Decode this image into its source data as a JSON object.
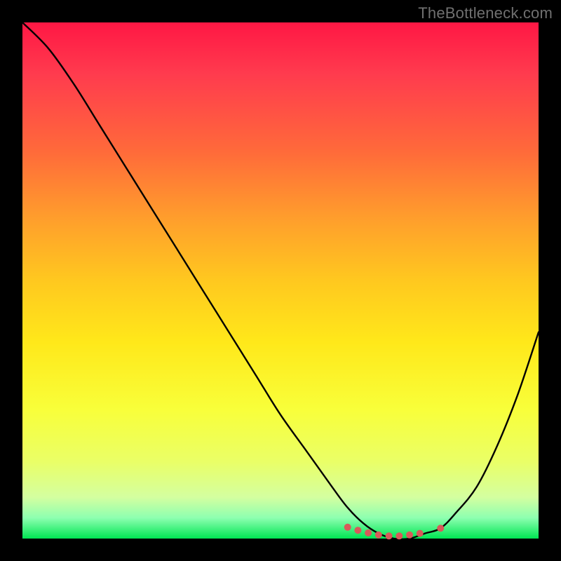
{
  "watermark": "TheBottleneck.com",
  "colors": {
    "frame": "#000000",
    "gradient_top": "#ff1744",
    "gradient_mid": "#ffe81a",
    "gradient_bottom": "#00e653",
    "curve": "#000000",
    "dots": "#d85a5a"
  },
  "chart_data": {
    "type": "line",
    "title": "",
    "xlabel": "",
    "ylabel": "",
    "xlim": [
      0,
      100
    ],
    "ylim": [
      0,
      100
    ],
    "note": "Values estimated from pixel positions on a 0–100 normalized axis. Higher y = higher on image (closer to red). Curve descends from top-left, bottoms out near x≈73, then rises toward the right edge.",
    "series": [
      {
        "name": "bottleneck-curve",
        "x": [
          0,
          5,
          10,
          15,
          20,
          25,
          30,
          35,
          40,
          45,
          50,
          55,
          60,
          63,
          66,
          69,
          72,
          75,
          78,
          81,
          84,
          88,
          92,
          96,
          100
        ],
        "y": [
          100,
          95,
          88,
          80,
          72,
          64,
          56,
          48,
          40,
          32,
          24,
          17,
          10,
          6,
          3,
          1,
          0,
          0,
          1,
          2,
          5,
          10,
          18,
          28,
          40
        ]
      }
    ],
    "trough_markers": {
      "name": "optimal-range-dots",
      "x": [
        63,
        65,
        67,
        69,
        71,
        73,
        75,
        77,
        81
      ],
      "y": [
        2.2,
        1.6,
        1.1,
        0.7,
        0.5,
        0.5,
        0.7,
        1.0,
        2.0
      ]
    }
  }
}
